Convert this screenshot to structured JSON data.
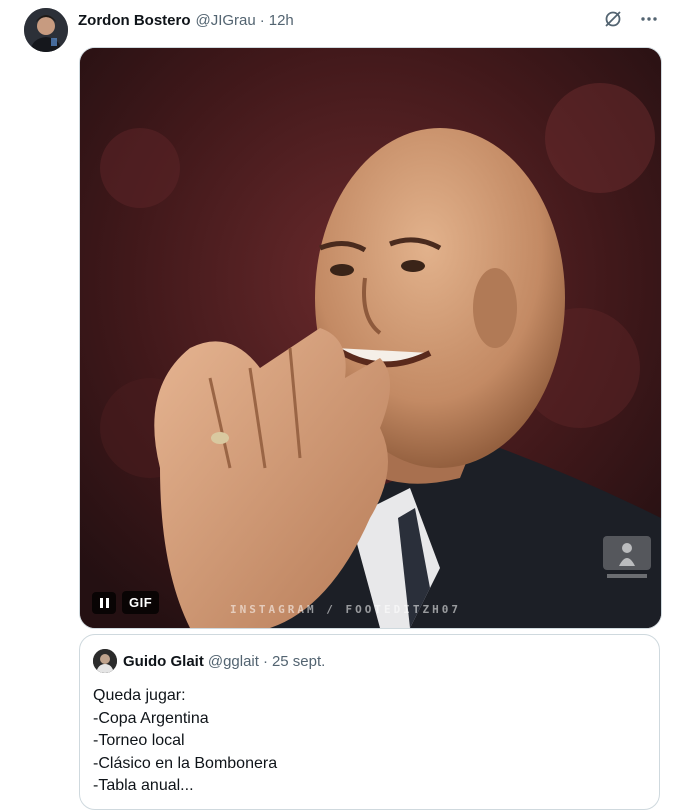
{
  "tweet": {
    "author_name": "Zordon Bostero",
    "author_handle": "@JIGrau",
    "separator": "·",
    "time": "12h",
    "top_icons": [
      "grok-icon",
      "more-icon"
    ],
    "more_label": "···"
  },
  "media": {
    "badge": "GIF",
    "playback_state": "playing",
    "watermark": "INSTAGRAM / FOOTEDITZH07"
  },
  "quoted_tweet": {
    "author_name": "Guido Glait",
    "author_handle": "@gglait",
    "separator": "·",
    "date": "25 sept.",
    "lines": [
      "Queda jugar:",
      "-Copa Argentina",
      "-Torneo local",
      "-Clásico en la Bombonera",
      "-Tabla anual..."
    ]
  },
  "colors": {
    "text_primary": "#0f1419",
    "text_secondary": "#536471",
    "border": "#cfd9de"
  }
}
